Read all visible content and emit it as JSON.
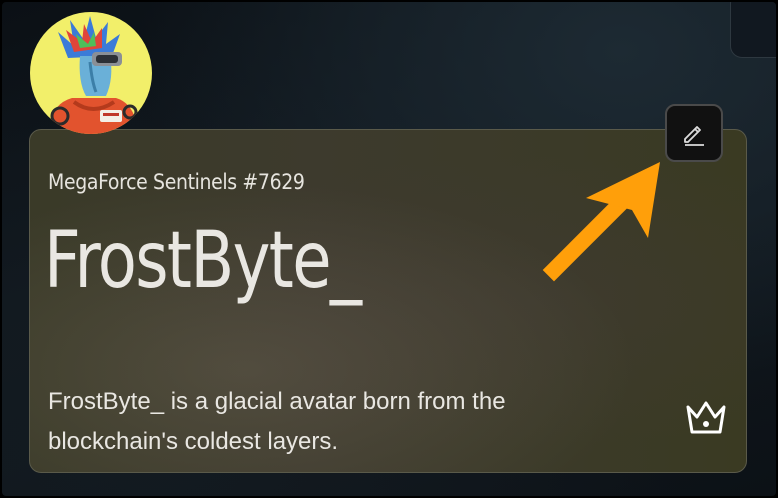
{
  "card": {
    "collection": "MegaForce Sentinels #7629",
    "name": "FrostByte_",
    "description": "FrostByte_ is a glacial avatar born from the blockchain's coldest layers."
  },
  "icons": {
    "edit": "pencil-icon",
    "badge": "crown-icon",
    "annotation": "arrow-icon"
  },
  "colors": {
    "avatar_background": "#f2ef6a",
    "annotation_arrow": "#ff9f0a",
    "card_background": "#3a3a28"
  }
}
